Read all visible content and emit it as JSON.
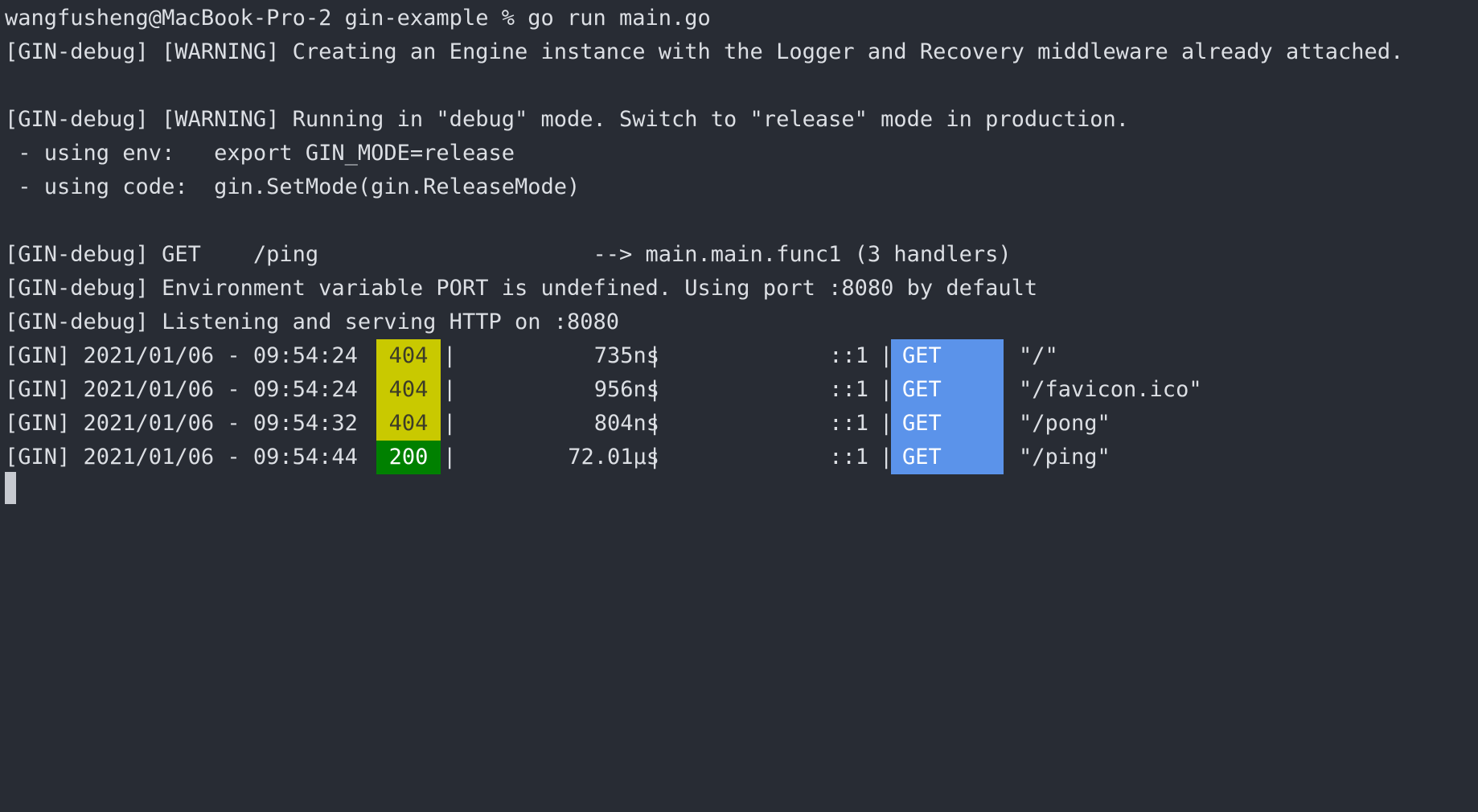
{
  "terminal": {
    "prompt_line": "wangfusheng@MacBook-Pro-2 gin-example % go run main.go",
    "lines": [
      "[GIN-debug] [WARNING] Creating an Engine instance with the Logger and Recovery middleware already attached.",
      "",
      "[GIN-debug] [WARNING] Running in \"debug\" mode. Switch to \"release\" mode in production.",
      " - using env:   export GIN_MODE=release",
      " - using code:  gin.SetMode(gin.ReleaseMode)",
      "",
      "[GIN-debug] GET    /ping                     --> main.main.func1 (3 handlers)",
      "[GIN-debug] Environment variable PORT is undefined. Using port :8080 by default",
      "[GIN-debug] Listening and serving HTTP on :8080"
    ],
    "requests": [
      {
        "prefix": "[GIN] 2021/01/06 - 09:54:24 |",
        "status": "404",
        "latency": "735ns",
        "client": "::1",
        "method": "GET",
        "path": "\"/\""
      },
      {
        "prefix": "[GIN] 2021/01/06 - 09:54:24 |",
        "status": "404",
        "latency": "956ns",
        "client": "::1",
        "method": "GET",
        "path": "\"/favicon.ico\""
      },
      {
        "prefix": "[GIN] 2021/01/06 - 09:54:32 |",
        "status": "404",
        "latency": "804ns",
        "client": "::1",
        "method": "GET",
        "path": "\"/pong\""
      },
      {
        "prefix": "[GIN] 2021/01/06 - 09:54:44 |",
        "status": "200",
        "latency": "72.01µs",
        "client": "::1",
        "method": "GET",
        "path": "\"/ping\""
      }
    ],
    "separator": "|",
    "colors": {
      "background": "#282c34",
      "text": "#dcdfe4",
      "status_404": "#c9c900",
      "status_200": "#008000",
      "method_get": "#5b93ea"
    }
  }
}
